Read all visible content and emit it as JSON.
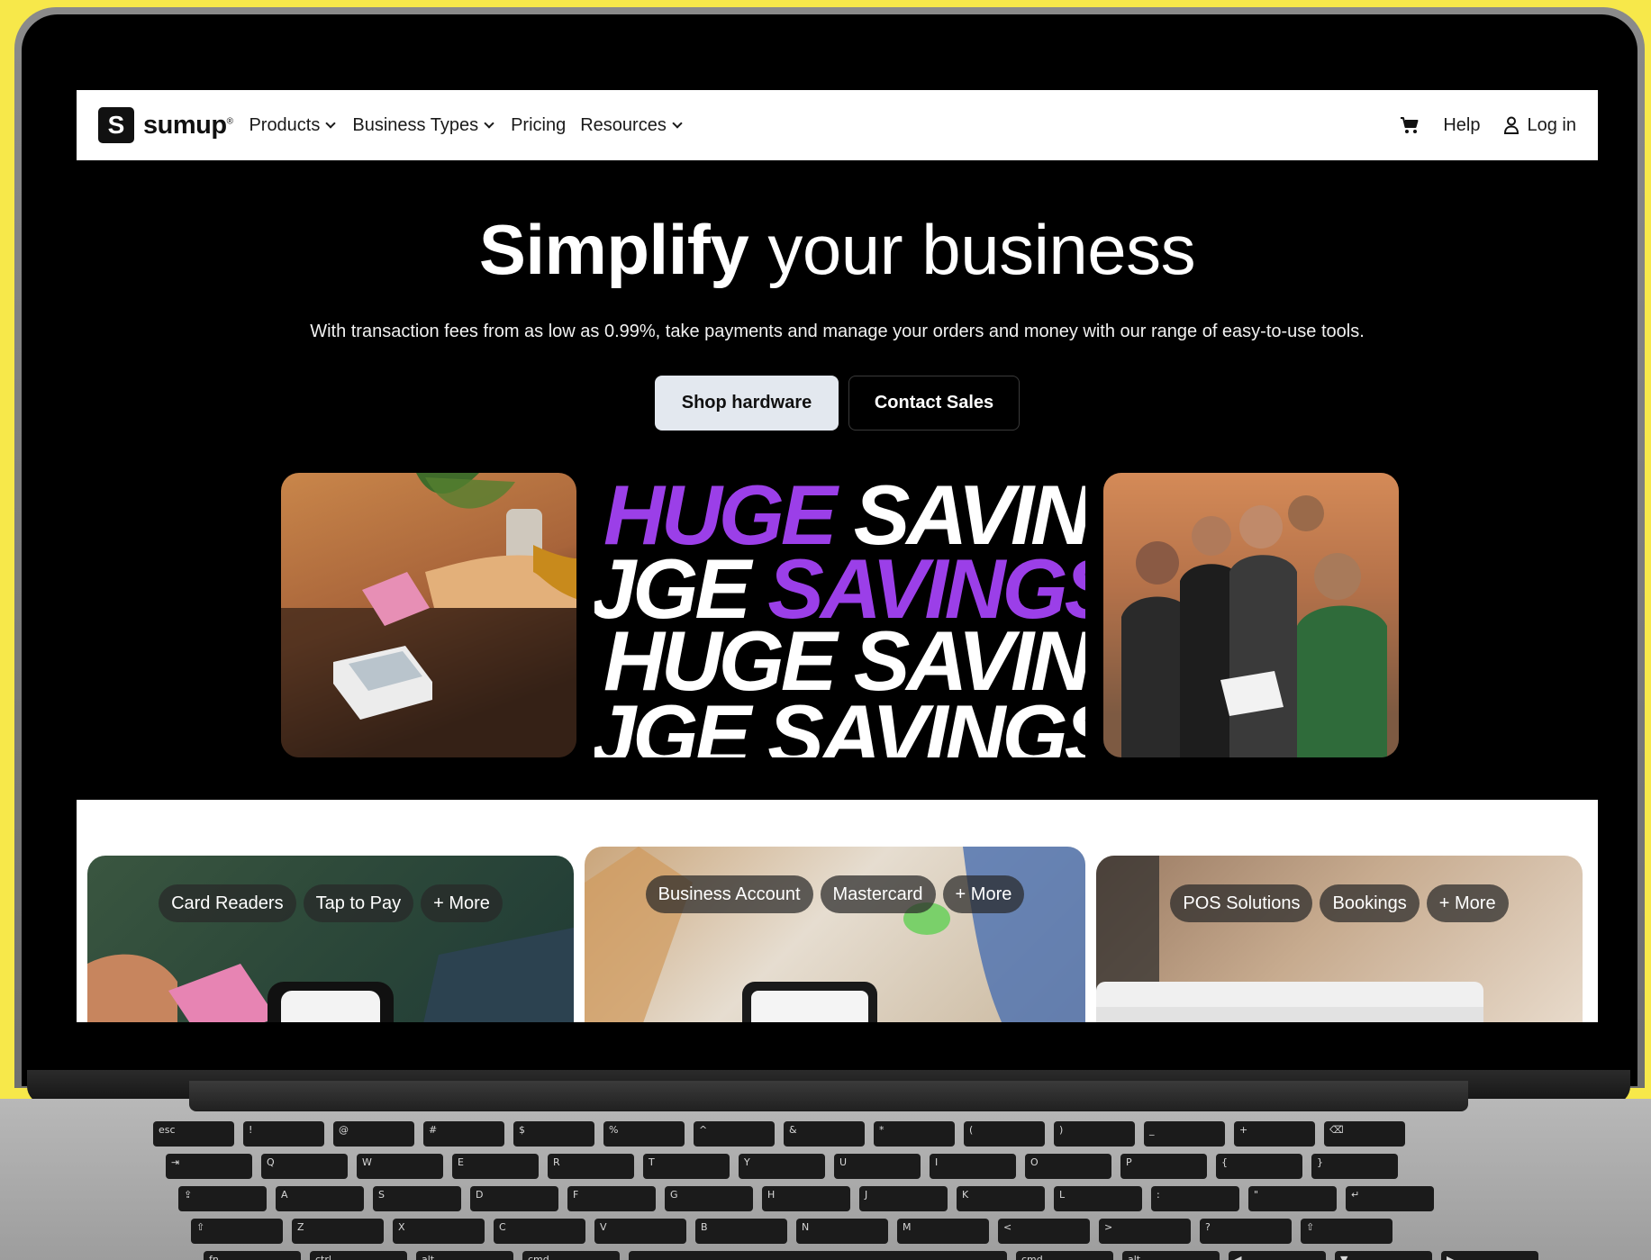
{
  "nav": {
    "logo_text": "sumup",
    "logo_mark": "S",
    "registered": "®",
    "items": [
      {
        "label": "Products",
        "has_dropdown": true
      },
      {
        "label": "Business Types",
        "has_dropdown": true
      },
      {
        "label": "Pricing",
        "has_dropdown": false
      },
      {
        "label": "Resources",
        "has_dropdown": true
      }
    ],
    "help_label": "Help",
    "login_label": "Log in",
    "cart_icon": "cart-icon",
    "user_icon": "user-icon"
  },
  "hero": {
    "title_bold": "Simplify",
    "title_rest": "your business",
    "subtitle": "With transaction fees from as low as 0.99%, take payments and manage your orders and money with our range of easy-to-use tools.",
    "primary_cta": "Shop hardware",
    "secondary_cta": "Contact Sales"
  },
  "banner": {
    "word_huge": "HUGE",
    "word_savings": "SAVINGS",
    "line1_a": "HUGE",
    "line1_b": "SAVIN(",
    "line2_a": "JGE",
    "line2_b": "SAVINGS",
    "line3_a": "HUGE",
    "line3_b": "SAVIN(",
    "line4_a": "JGE",
    "line4_b": "SAVINGS",
    "accent_color": "#9b3fe8"
  },
  "product_cards": [
    {
      "pills": [
        "Card Readers",
        "Tap to Pay",
        "+ More"
      ]
    },
    {
      "pills": [
        "Business Account",
        "Mastercard",
        "+ More"
      ]
    },
    {
      "pills": [
        "POS Solutions",
        "Bookings",
        "+ More"
      ]
    }
  ],
  "keyboard": {
    "row1": [
      "esc",
      "!",
      "@",
      "#",
      "$",
      "%",
      "^",
      "&",
      "*",
      "(",
      ")",
      "_",
      "+",
      "⌫"
    ],
    "row2": [
      "⇥",
      "Q",
      "W",
      "E",
      "R",
      "T",
      "Y",
      "U",
      "I",
      "O",
      "P",
      "{",
      "}"
    ],
    "row3": [
      "⇪",
      "A",
      "S",
      "D",
      "F",
      "G",
      "H",
      "J",
      "K",
      "L",
      ":",
      "\"",
      "↵"
    ],
    "row4": [
      "⇧",
      "Z",
      "X",
      "C",
      "V",
      "B",
      "N",
      "M",
      "<",
      ">",
      "?",
      "⇧"
    ],
    "row5": [
      "fn",
      "ctrl",
      "alt",
      "cmd",
      "",
      "cmd",
      "alt",
      "◀",
      "▼",
      "▶"
    ]
  },
  "colors": {
    "background": "#f7e84a",
    "screen_bg": "#000000",
    "button_primary_bg": "#e3e8ef"
  }
}
